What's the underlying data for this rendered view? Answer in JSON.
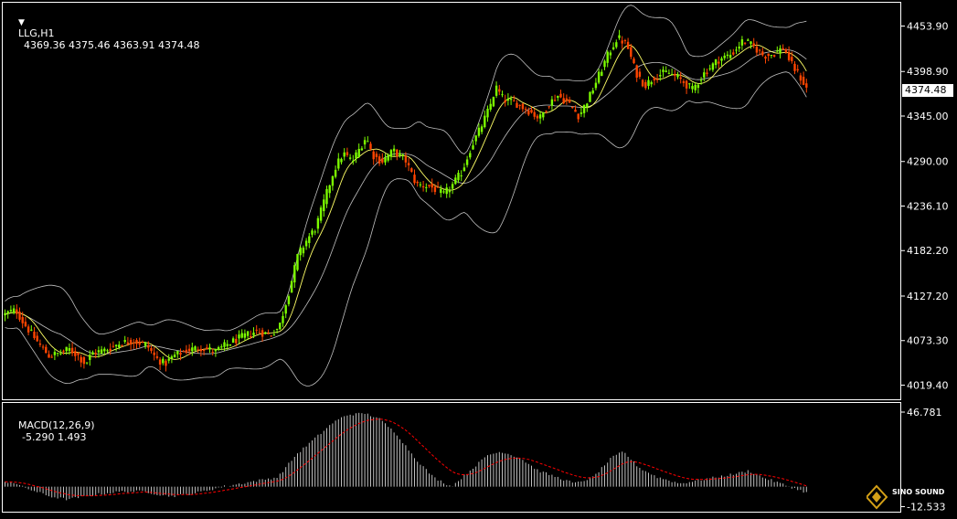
{
  "header": {
    "symbol_tf": "LLG,H1",
    "ohlc": "4369.36 4375.46 4363.91 4374.48"
  },
  "macd_header": {
    "label": "MACD(12,26,9)",
    "values": "-5.290 1.493"
  },
  "price_axis": {
    "ticks": [
      "4453.90",
      "4398.90",
      "4345.00",
      "4290.00",
      "4236.10",
      "4182.20",
      "4127.20",
      "4073.30",
      "4019.40"
    ],
    "current": "4374.48"
  },
  "macd_axis": {
    "ticks": [
      "46.781",
      "-12.533"
    ]
  },
  "logo": {
    "text": "SINO SOUND"
  },
  "colors": {
    "background": "#000000",
    "bull_candle": "#7CFC00",
    "bear_candle": "#FF4500",
    "band_line": "#C0C0C0",
    "ma_line": "#FFFF66",
    "macd_hist": "#C0C0C0",
    "macd_signal": "#FF0000",
    "grid_border": "#FFFFFF"
  },
  "chart_data": {
    "type": "candlestick",
    "timeframe": "H1",
    "overlays": [
      "bollinger-bands",
      "moving-average"
    ],
    "ylim": [
      4000,
      4475
    ],
    "path_points": [
      [
        0,
        4105
      ],
      [
        5,
        4108
      ],
      [
        12,
        4110
      ],
      [
        20,
        4095
      ],
      [
        30,
        4080
      ],
      [
        40,
        4065
      ],
      [
        48,
        4055
      ],
      [
        60,
        4058
      ],
      [
        70,
        4063
      ],
      [
        80,
        4055
      ],
      [
        88,
        4045
      ],
      [
        95,
        4058
      ],
      [
        110,
        4062
      ],
      [
        125,
        4070
      ],
      [
        140,
        4073
      ],
      [
        155,
        4068
      ],
      [
        165,
        4052
      ],
      [
        175,
        4045
      ],
      [
        185,
        4055
      ],
      [
        200,
        4062
      ],
      [
        215,
        4065
      ],
      [
        230,
        4060
      ],
      [
        245,
        4070
      ],
      [
        260,
        4078
      ],
      [
        275,
        4085
      ],
      [
        290,
        4080
      ],
      [
        300,
        4090
      ],
      [
        310,
        4130
      ],
      [
        320,
        4175
      ],
      [
        330,
        4195
      ],
      [
        340,
        4210
      ],
      [
        350,
        4245
      ],
      [
        360,
        4280
      ],
      [
        370,
        4300
      ],
      [
        380,
        4290
      ],
      [
        390,
        4310
      ],
      [
        395,
        4320
      ],
      [
        402,
        4298
      ],
      [
        412,
        4290
      ],
      [
        425,
        4303
      ],
      [
        438,
        4292
      ],
      [
        450,
        4262
      ],
      [
        465,
        4260
      ],
      [
        480,
        4250
      ],
      [
        490,
        4262
      ],
      [
        500,
        4278
      ],
      [
        510,
        4308
      ],
      [
        520,
        4330
      ],
      [
        530,
        4355
      ],
      [
        537,
        4380
      ],
      [
        545,
        4365
      ],
      [
        560,
        4360
      ],
      [
        575,
        4350
      ],
      [
        585,
        4342
      ],
      [
        595,
        4360
      ],
      [
        605,
        4370
      ],
      [
        615,
        4362
      ],
      [
        628,
        4345
      ],
      [
        640,
        4370
      ],
      [
        650,
        4395
      ],
      [
        660,
        4420
      ],
      [
        670,
        4440
      ],
      [
        680,
        4432
      ],
      [
        690,
        4398
      ],
      [
        700,
        4382
      ],
      [
        712,
        4394
      ],
      [
        725,
        4398
      ],
      [
        738,
        4390
      ],
      [
        752,
        4377
      ],
      [
        765,
        4397
      ],
      [
        780,
        4413
      ],
      [
        795,
        4420
      ],
      [
        808,
        4437
      ],
      [
        820,
        4428
      ],
      [
        830,
        4418
      ],
      [
        840,
        4420
      ],
      [
        852,
        4428
      ],
      [
        860,
        4408
      ],
      [
        870,
        4392
      ],
      [
        880,
        4372
      ]
    ],
    "macd_path": [
      [
        0,
        3
      ],
      [
        10,
        3
      ],
      [
        20,
        0
      ],
      [
        30,
        -2
      ],
      [
        40,
        -4
      ],
      [
        50,
        -6
      ],
      [
        60,
        -7
      ],
      [
        70,
        -8
      ],
      [
        80,
        -7
      ],
      [
        100,
        -5
      ],
      [
        130,
        -3
      ],
      [
        155,
        -3
      ],
      [
        170,
        -5
      ],
      [
        185,
        -6
      ],
      [
        210,
        -4
      ],
      [
        240,
        0
      ],
      [
        270,
        3
      ],
      [
        300,
        6
      ],
      [
        320,
        20
      ],
      [
        340,
        30
      ],
      [
        360,
        40
      ],
      [
        375,
        45
      ],
      [
        395,
        46
      ],
      [
        410,
        43
      ],
      [
        430,
        33
      ],
      [
        450,
        18
      ],
      [
        470,
        6
      ],
      [
        490,
        0
      ],
      [
        510,
        10
      ],
      [
        530,
        20
      ],
      [
        545,
        22
      ],
      [
        565,
        18
      ],
      [
        585,
        10
      ],
      [
        605,
        6
      ],
      [
        625,
        2
      ],
      [
        645,
        6
      ],
      [
        665,
        18
      ],
      [
        678,
        22
      ],
      [
        695,
        12
      ],
      [
        715,
        6
      ],
      [
        740,
        2
      ],
      [
        760,
        4
      ],
      [
        780,
        6
      ],
      [
        800,
        8
      ],
      [
        815,
        10
      ],
      [
        830,
        6
      ],
      [
        850,
        2
      ],
      [
        870,
        -2
      ],
      [
        880,
        -4
      ]
    ]
  }
}
